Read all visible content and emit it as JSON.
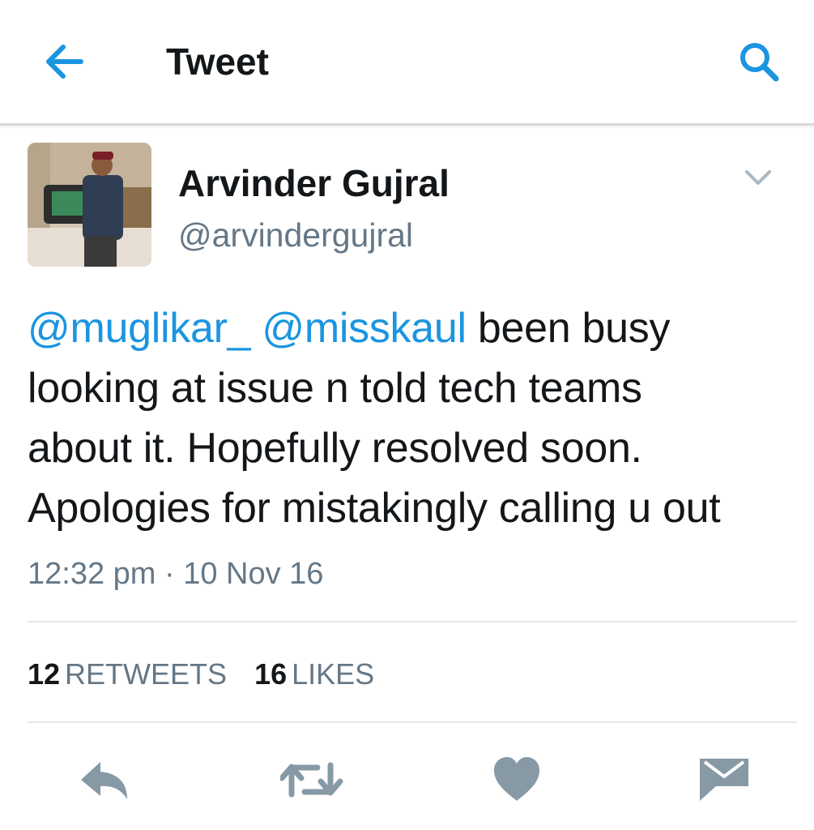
{
  "header": {
    "title": "Tweet",
    "back_icon": "arrow-left-icon",
    "search_icon": "search-icon"
  },
  "author": {
    "name": "Arvinder Gujral",
    "handle": "@arvindergujral"
  },
  "tweet": {
    "lines": [
      [
        {
          "text": "@muglikar_",
          "mention": true
        },
        {
          "text": " ",
          "mention": false
        },
        {
          "text": "@misskaul",
          "mention": true
        },
        {
          "text": " been busy",
          "mention": false
        }
      ],
      [
        {
          "text": "looking at issue n told tech teams",
          "mention": false
        }
      ],
      [
        {
          "text": "about it. Hopefully resolved soon.",
          "mention": false
        }
      ],
      [
        {
          "text": "Apologies for mistakingly calling u out",
          "mention": false
        }
      ]
    ],
    "timestamp": "12:32 pm · 10 Nov 16"
  },
  "stats": {
    "retweets_count": "12",
    "retweets_label": "RETWEETS",
    "likes_count": "16",
    "likes_label": "LIKES"
  },
  "actions": [
    "reply-icon",
    "retweet-icon",
    "like-icon",
    "message-icon"
  ],
  "colors": {
    "accent": "#1b95e0",
    "text": "#14171a",
    "secondary": "#657786",
    "icon": "#8899a6"
  }
}
